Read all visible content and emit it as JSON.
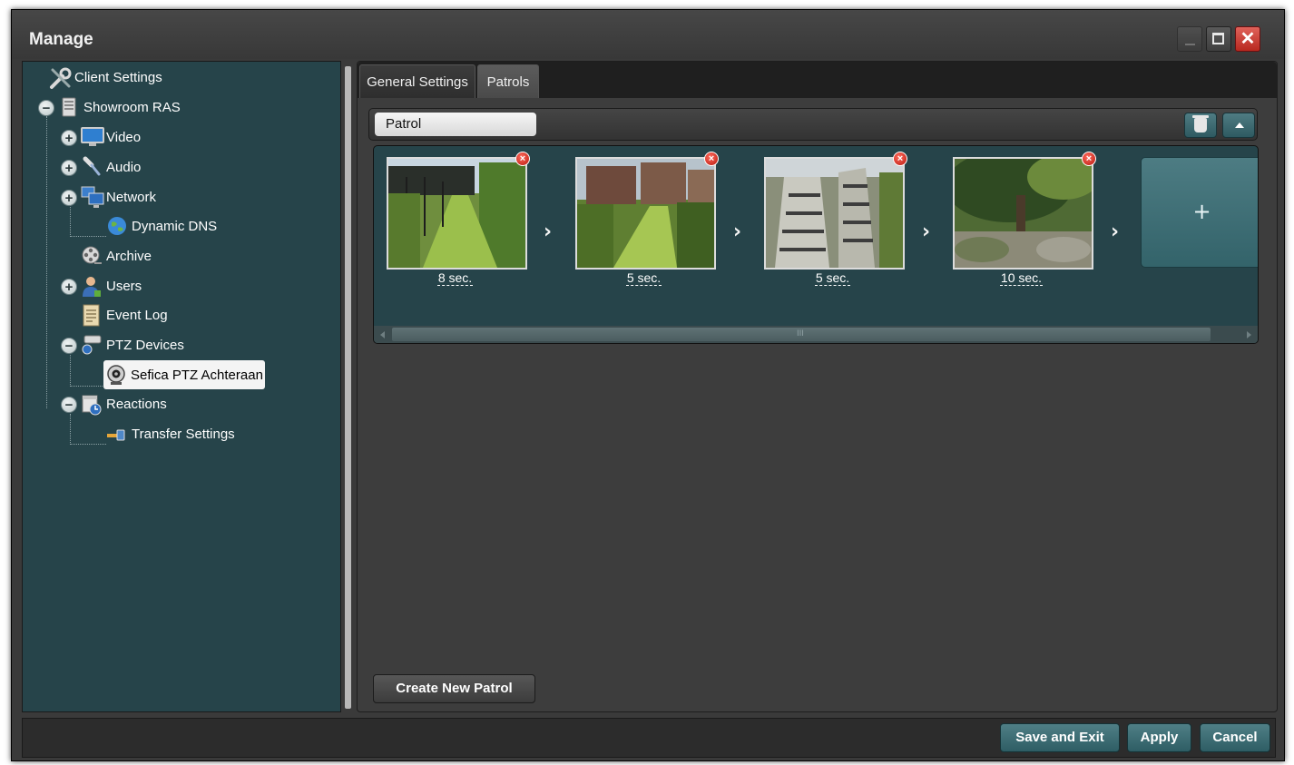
{
  "window": {
    "title": "Manage"
  },
  "window_controls": {
    "minimize": "minimize",
    "maximize": "maximize",
    "close": "✕"
  },
  "sidebar": {
    "items": [
      {
        "label": "Client Settings",
        "icon": "tools-icon"
      },
      {
        "label": "Showroom RAS",
        "icon": "server-icon",
        "expander": "−"
      },
      {
        "label": "Video",
        "icon": "monitor-icon",
        "expander": "+"
      },
      {
        "label": "Audio",
        "icon": "microphone-icon",
        "expander": "+"
      },
      {
        "label": "Network",
        "icon": "network-icon",
        "expander": "+"
      },
      {
        "label": "Dynamic DNS",
        "icon": "globe-icon"
      },
      {
        "label": "Archive",
        "icon": "film-reel-icon"
      },
      {
        "label": "Users",
        "icon": "user-icon",
        "expander": "+"
      },
      {
        "label": "Event Log",
        "icon": "document-icon"
      },
      {
        "label": "PTZ Devices",
        "icon": "ptz-camera-icon",
        "expander": "−"
      },
      {
        "label": "Sefica PTZ Achteraan",
        "icon": "webcam-icon",
        "selected": true
      },
      {
        "label": "Reactions",
        "icon": "calendar-clock-icon",
        "expander": "−"
      },
      {
        "label": "Transfer Settings",
        "icon": "transfer-icon"
      }
    ]
  },
  "tabs": [
    {
      "label": "General Settings",
      "active": false
    },
    {
      "label": "Patrols",
      "active": true
    }
  ],
  "patrol": {
    "name": "Patrol",
    "steps": [
      {
        "dwell": "8 sec.",
        "remove": "×"
      },
      {
        "dwell": "5 sec.",
        "remove": "×"
      },
      {
        "dwell": "5 sec.",
        "remove": "×"
      },
      {
        "dwell": "10 sec.",
        "remove": "×"
      }
    ],
    "arrow": "›",
    "add_label": "+",
    "scroll_grip": "III"
  },
  "actions": {
    "create_label": "Create New Patrol",
    "save_exit_label": "Save and Exit",
    "apply_label": "Apply",
    "cancel_label": "Cancel"
  },
  "colors": {
    "panel_teal": "#26444a",
    "button_teal": "#3e6d74",
    "close_red": "#c8352b",
    "background": "#3a3a3a"
  }
}
